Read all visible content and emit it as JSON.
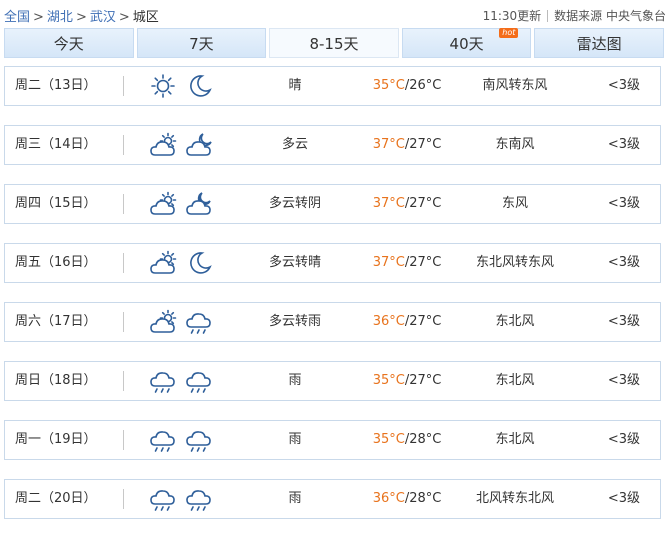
{
  "breadcrumb": {
    "home": "全国",
    "province": "湖北",
    "city": "武汉",
    "district": "城区",
    "separator": ">"
  },
  "meta": {
    "update": "11:30更新",
    "source": "数据来源 中央气象台"
  },
  "tabs": [
    {
      "label": "今天",
      "active": false
    },
    {
      "label": "7天",
      "active": false
    },
    {
      "label": "8-15天",
      "active": true
    },
    {
      "label": "40天",
      "active": false,
      "badge": "hot"
    },
    {
      "label": "雷达图",
      "active": false
    }
  ],
  "forecast": [
    {
      "day": "周二（13日）",
      "icons": [
        "sun-icon",
        "moon-icon"
      ],
      "weather": "晴",
      "high": "35°C",
      "low": "/26°C",
      "wind": "南风转东风",
      "level": "<3级"
    },
    {
      "day": "周三（14日）",
      "icons": [
        "partly-cloudy-icon",
        "partly-cloudy-night-icon"
      ],
      "weather": "多云",
      "high": "37°C",
      "low": "/27°C",
      "wind": "东南风",
      "level": "<3级"
    },
    {
      "day": "周四（15日）",
      "icons": [
        "partly-cloudy-icon",
        "cloudy-moon-icon"
      ],
      "weather": "多云转阴",
      "high": "37°C",
      "low": "/27°C",
      "wind": "东风",
      "level": "<3级"
    },
    {
      "day": "周五（16日）",
      "icons": [
        "partly-cloudy-icon",
        "moon-icon"
      ],
      "weather": "多云转晴",
      "high": "37°C",
      "low": "/27°C",
      "wind": "东北风转东风",
      "level": "<3级"
    },
    {
      "day": "周六（17日）",
      "icons": [
        "partly-cloudy-icon",
        "rain-icon"
      ],
      "weather": "多云转雨",
      "high": "36°C",
      "low": "/27°C",
      "wind": "东北风",
      "level": "<3级"
    },
    {
      "day": "周日（18日）",
      "icons": [
        "rain-icon",
        "rain-icon"
      ],
      "weather": "雨",
      "high": "35°C",
      "low": "/27°C",
      "wind": "东北风",
      "level": "<3级"
    },
    {
      "day": "周一（19日）",
      "icons": [
        "rain-icon",
        "rain-icon"
      ],
      "weather": "雨",
      "high": "35°C",
      "low": "/28°C",
      "wind": "东北风",
      "level": "<3级"
    },
    {
      "day": "周二（20日）",
      "icons": [
        "rain-icon",
        "rain-icon"
      ],
      "weather": "雨",
      "high": "36°C",
      "low": "/28°C",
      "wind": "北风转东北风",
      "level": "<3级"
    }
  ],
  "colors": {
    "accent": "#3f6fb5",
    "high_temp": "#e8731d",
    "icon_stroke": "#2f5f9a",
    "hot_badge": "#f46d1a"
  }
}
